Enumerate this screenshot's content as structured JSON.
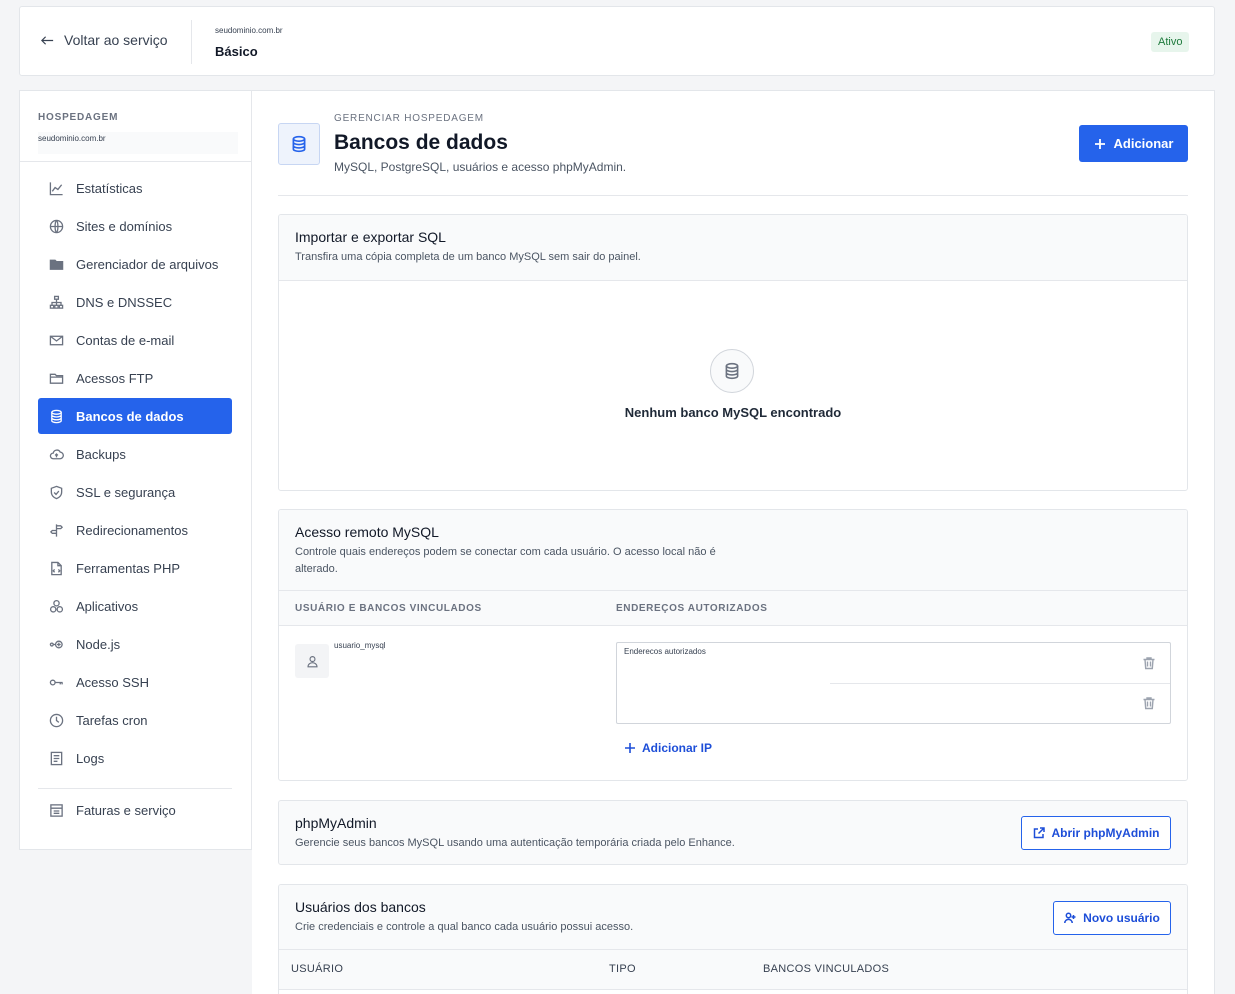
{
  "header": {
    "back_label": "Voltar ao serviço",
    "domain": "seudominio.com.br",
    "plan": "Básico",
    "status": "Ativo"
  },
  "sidebar": {
    "heading": "HOSPEDAGEM",
    "domain": "seudominio.com.br",
    "items": [
      {
        "label": "Estatísticas",
        "icon": "chart-icon"
      },
      {
        "label": "Sites e domínios",
        "icon": "globe-icon"
      },
      {
        "label": "Gerenciador de arquivos",
        "icon": "folder-icon"
      },
      {
        "label": "DNS e DNSSEC",
        "icon": "network-icon"
      },
      {
        "label": "Contas de e-mail",
        "icon": "mail-icon"
      },
      {
        "label": "Acessos FTP",
        "icon": "folder-open-icon"
      },
      {
        "label": "Bancos de dados",
        "icon": "database-icon",
        "active": true
      },
      {
        "label": "Backups",
        "icon": "cloud-upload-icon"
      },
      {
        "label": "SSL e segurança",
        "icon": "shield-icon"
      },
      {
        "label": "Redirecionamentos",
        "icon": "signpost-icon"
      },
      {
        "label": "Ferramentas PHP",
        "icon": "file-code-icon"
      },
      {
        "label": "Aplicativos",
        "icon": "apps-icon"
      },
      {
        "label": "Node.js",
        "icon": "node-icon"
      },
      {
        "label": "Acesso SSH",
        "icon": "key-icon"
      },
      {
        "label": "Tarefas cron",
        "icon": "clock-icon"
      },
      {
        "label": "Logs",
        "icon": "log-icon"
      }
    ],
    "footer_item": {
      "label": "Faturas e serviço",
      "icon": "invoice-icon"
    }
  },
  "page": {
    "eyebrow": "GERENCIAR HOSPEDAGEM",
    "title": "Bancos de dados",
    "subtitle": "MySQL, PostgreSQL, usuários e acesso phpMyAdmin.",
    "add_label": "Adicionar"
  },
  "import_export": {
    "title": "Importar e exportar SQL",
    "description": "Transfira uma cópia completa de um banco MySQL sem sair do painel.",
    "empty_text": "Nenhum banco MySQL encontrado"
  },
  "remote_access": {
    "title": "Acesso remoto MySQL",
    "description": "Controle quais endereços podem se conectar com cada usuário. O acesso local não é alterado.",
    "col_users": "USUÁRIO E BANCOS VINCULADOS",
    "col_addresses": "ENDEREÇOS AUTORIZADOS",
    "user": "usuario_mysql",
    "addresses_label": "Enderecos autorizados",
    "add_ip_label": "Adicionar IP"
  },
  "phpmyadmin": {
    "title": "phpMyAdmin",
    "description": "Gerencie seus bancos MySQL usando uma autenticação temporária criada pelo Enhance.",
    "button": "Abrir phpMyAdmin"
  },
  "db_users": {
    "title": "Usuários dos bancos",
    "description": "Crie credenciais e controle a qual banco cada usuário possui acesso.",
    "button": "Novo usuário",
    "columns": [
      "USUÁRIO",
      "TIPO",
      "BANCOS VINCULADOS"
    ]
  },
  "colors": {
    "accent": "#2563eb",
    "active_badge_bg": "#e7f5ec",
    "active_badge_text": "#1e7a3c"
  }
}
